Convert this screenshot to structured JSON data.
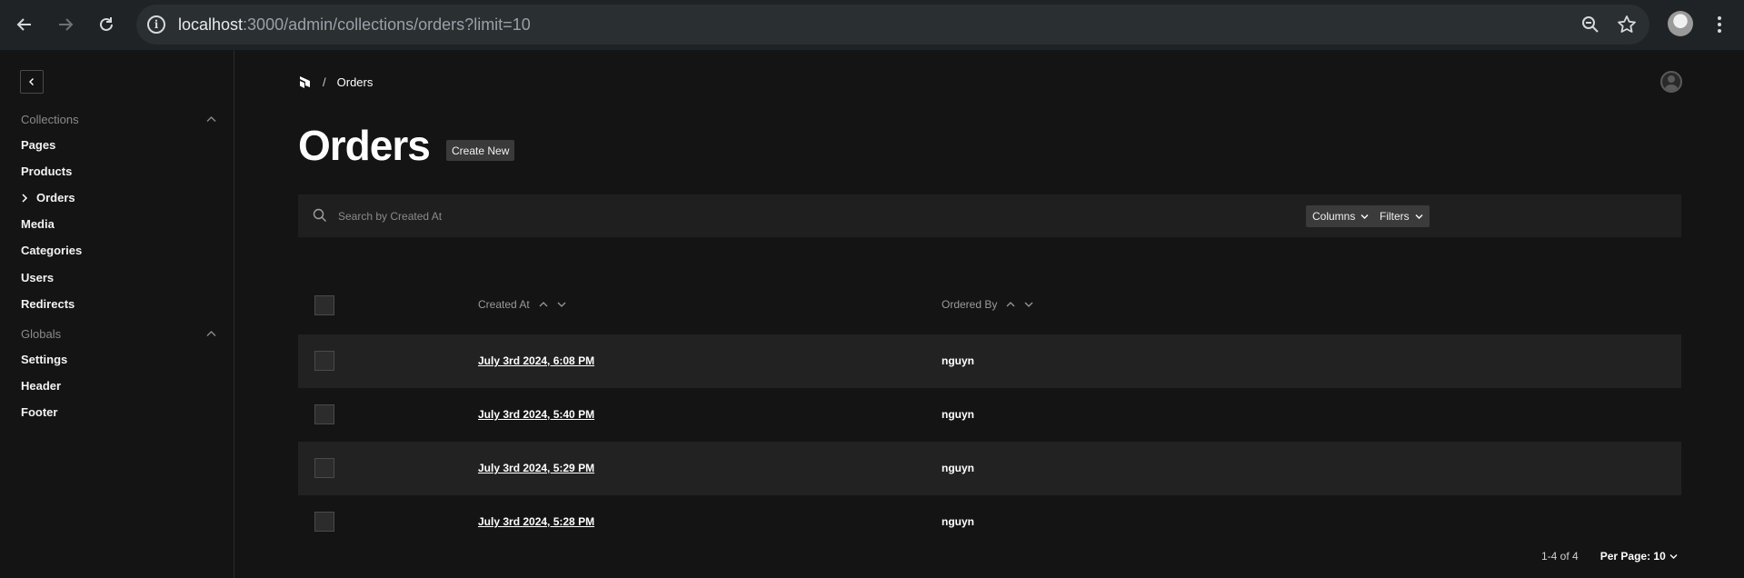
{
  "browser": {
    "url_host": "localhost",
    "url_rest": ":3000/admin/collections/orders?limit=10"
  },
  "sidebar": {
    "collections_label": "Collections",
    "collections": [
      {
        "label": "Pages"
      },
      {
        "label": "Products"
      },
      {
        "label": "Orders",
        "active": true
      },
      {
        "label": "Media"
      },
      {
        "label": "Categories"
      },
      {
        "label": "Users"
      },
      {
        "label": "Redirects"
      }
    ],
    "globals_label": "Globals",
    "globals": [
      {
        "label": "Settings"
      },
      {
        "label": "Header"
      },
      {
        "label": "Footer"
      }
    ]
  },
  "breadcrumb": {
    "separator": "/",
    "current": "Orders"
  },
  "page": {
    "title": "Orders",
    "create_label": "Create New"
  },
  "search": {
    "placeholder": "Search by Created At",
    "columns_label": "Columns",
    "filters_label": "Filters"
  },
  "table": {
    "headers": [
      "Created At",
      "Ordered By"
    ],
    "rows": [
      {
        "created_at": "July 3rd 2024, 6:08 PM",
        "ordered_by": "nguyn"
      },
      {
        "created_at": "July 3rd 2024, 5:40 PM",
        "ordered_by": "nguyn"
      },
      {
        "created_at": "July 3rd 2024, 5:29 PM",
        "ordered_by": "nguyn"
      },
      {
        "created_at": "July 3rd 2024, 5:28 PM",
        "ordered_by": "nguyn"
      }
    ]
  },
  "pagination": {
    "range": "1-4 of 4",
    "per_page_label": "Per Page: 10"
  }
}
